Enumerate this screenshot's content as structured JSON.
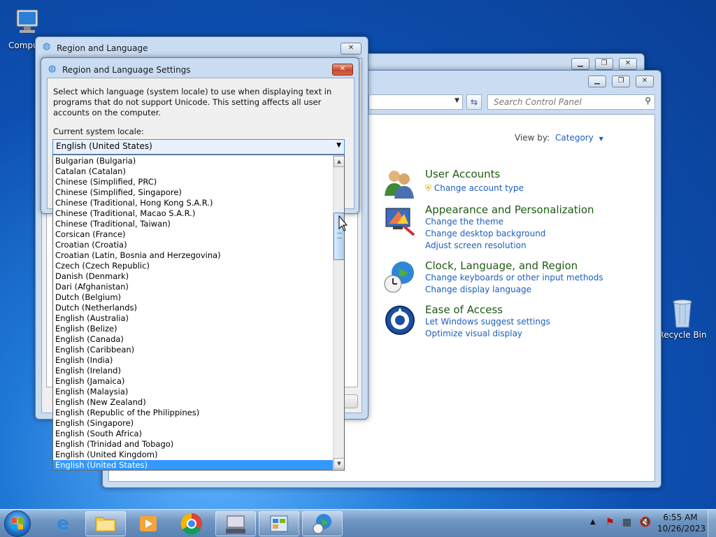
{
  "desktop": {
    "computer_label": "Compu",
    "recycle_label": "Recycle Bin"
  },
  "control_panel": {
    "search_placeholder": "Search Control Panel",
    "view_by_label": "View by:",
    "view_by_value": "Category",
    "categories": [
      {
        "heading": "User Accounts",
        "links": [
          "Change account type"
        ]
      },
      {
        "heading": "Appearance and Personalization",
        "links": [
          "Change the theme",
          "Change desktop background",
          "Adjust screen resolution"
        ]
      },
      {
        "heading": "Clock, Language, and Region",
        "links": [
          "Change keyboards or other input methods",
          "Change display language"
        ]
      },
      {
        "heading": "Ease of Access",
        "links": [
          "Let Windows suggest settings",
          "Optimize visual display"
        ]
      }
    ]
  },
  "region_dialog": {
    "title": "Region and Language"
  },
  "settings_dialog": {
    "title": "Region and Language Settings",
    "description": "Select which language (system locale) to use when displaying text in programs that do not support Unicode. This setting affects all user accounts on the computer.",
    "locale_label": "Current system locale:",
    "current_locale": "English (United States)",
    "locale_options": [
      "Bulgarian (Bulgaria)",
      "Catalan (Catalan)",
      "Chinese (Simplified, PRC)",
      "Chinese (Simplified, Singapore)",
      "Chinese (Traditional, Hong Kong S.A.R.)",
      "Chinese (Traditional, Macao S.A.R.)",
      "Chinese (Traditional, Taiwan)",
      "Corsican (France)",
      "Croatian (Croatia)",
      "Croatian (Latin, Bosnia and Herzegovina)",
      "Czech (Czech Republic)",
      "Danish (Denmark)",
      "Dari (Afghanistan)",
      "Dutch (Belgium)",
      "Dutch (Netherlands)",
      "English (Australia)",
      "English (Belize)",
      "English (Canada)",
      "English (Caribbean)",
      "English (India)",
      "English (Ireland)",
      "English (Jamaica)",
      "English (Malaysia)",
      "English (New Zealand)",
      "English (Republic of the Philippines)",
      "English (Singapore)",
      "English (South Africa)",
      "English (Trinidad and Tobago)",
      "English (United Kingdom)",
      "English (United States)"
    ],
    "selected_index": 29
  },
  "taskbar": {
    "time": "6:55 AM",
    "date": "10/26/2023"
  }
}
